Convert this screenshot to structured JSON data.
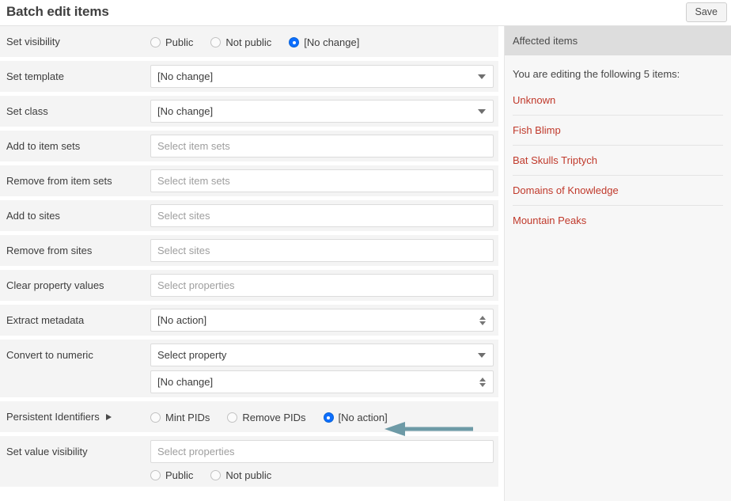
{
  "header": {
    "title": "Batch edit items",
    "save_label": "Save"
  },
  "form": {
    "set_visibility": {
      "label": "Set visibility",
      "options": [
        {
          "label": "Public",
          "checked": false
        },
        {
          "label": "Not public",
          "checked": false
        },
        {
          "label": "[No change]",
          "checked": true
        }
      ]
    },
    "set_template": {
      "label": "Set template",
      "value": "[No change]",
      "control": "chosen-select"
    },
    "set_class": {
      "label": "Set class",
      "value": "[No change]",
      "control": "chosen-select"
    },
    "add_to_item_sets": {
      "label": "Add to item sets",
      "value": "",
      "placeholder": "Select item sets"
    },
    "remove_from_item_sets": {
      "label": "Remove from item sets",
      "value": "",
      "placeholder": "Select item sets"
    },
    "add_to_sites": {
      "label": "Add to sites",
      "value": "",
      "placeholder": "Select sites"
    },
    "remove_from_sites": {
      "label": "Remove from sites",
      "value": "",
      "placeholder": "Select sites"
    },
    "clear_property_values": {
      "label": "Clear property values",
      "value": "",
      "placeholder": "Select properties"
    },
    "extract_metadata": {
      "label": "Extract metadata",
      "value": "[No action]",
      "control": "native-select"
    },
    "convert_to_numeric": {
      "label": "Convert to numeric",
      "property_value": "Select property",
      "action_value": "[No change]"
    },
    "persistent_identifiers": {
      "label": "Persistent Identifiers",
      "disclosure_icon": "triangle-right-icon",
      "options": [
        {
          "label": "Mint PIDs",
          "checked": false
        },
        {
          "label": "Remove PIDs",
          "checked": false
        },
        {
          "label": "[No action]",
          "checked": true
        }
      ]
    },
    "set_value_visibility": {
      "label": "Set value visibility",
      "value": "",
      "placeholder": "Select properties",
      "options": [
        {
          "label": "Public",
          "checked": false
        },
        {
          "label": "Not public",
          "checked": false
        }
      ]
    }
  },
  "side_panel": {
    "header": "Affected items",
    "note": "You are editing the following 5 items:",
    "items": [
      {
        "label": "Unknown"
      },
      {
        "label": "Fish Blimp"
      },
      {
        "label": "Bat Skulls Triptych"
      },
      {
        "label": "Domains of Knowledge"
      },
      {
        "label": "Mountain Peaks"
      }
    ]
  },
  "annotation": {
    "arrow_color": "#6d9aa6",
    "arrow_target": "[No action]"
  },
  "colors": {
    "radio_selected": "#0d6efd",
    "link_red": "#c0392b",
    "row_background": "#f4f4f4",
    "panel_header": "#dddddd"
  }
}
